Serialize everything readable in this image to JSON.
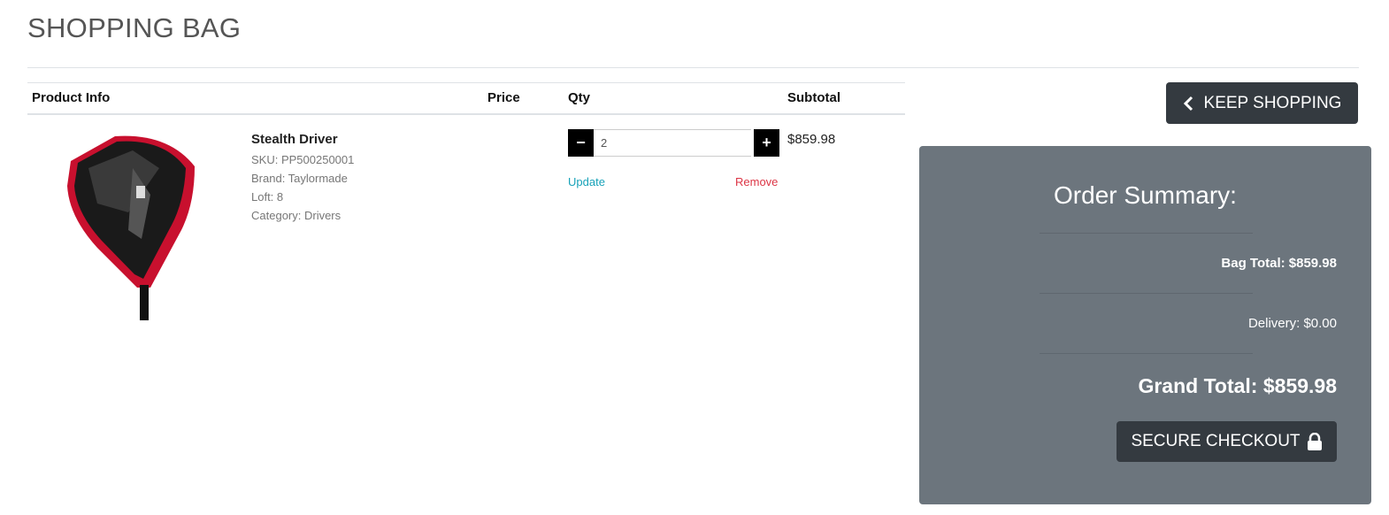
{
  "page": {
    "title": "SHOPPING BAG"
  },
  "table": {
    "headers": {
      "product_info": "Product Info",
      "price": "Price",
      "qty": "Qty",
      "subtotal": "Subtotal"
    },
    "items": [
      {
        "name": "Stealth Driver",
        "sku": "SKU: PP500250001",
        "brand": "Brand: Taylormade",
        "loft": "Loft: 8",
        "category": "Category: Drivers",
        "price": "",
        "qty": "2",
        "subtotal": "$859.98",
        "update_label": "Update",
        "remove_label": "Remove",
        "decrement_label": "−",
        "increment_label": "+"
      }
    ]
  },
  "actions": {
    "keep_shopping": "KEEP SHOPPING",
    "secure_checkout": "SECURE CHECKOUT"
  },
  "summary": {
    "title": "Order Summary:",
    "bag_total": "Bag Total: $859.98",
    "delivery": "Delivery: $0.00",
    "grand_total": "Grand Total: $859.98"
  },
  "colors": {
    "update_link": "#17a2b8",
    "remove_link": "#dc3545",
    "summary_bg": "#6c757d",
    "button_dark": "#343a40"
  },
  "icons": {
    "keep_shopping": "chevron-left-icon",
    "checkout": "lock-icon"
  }
}
